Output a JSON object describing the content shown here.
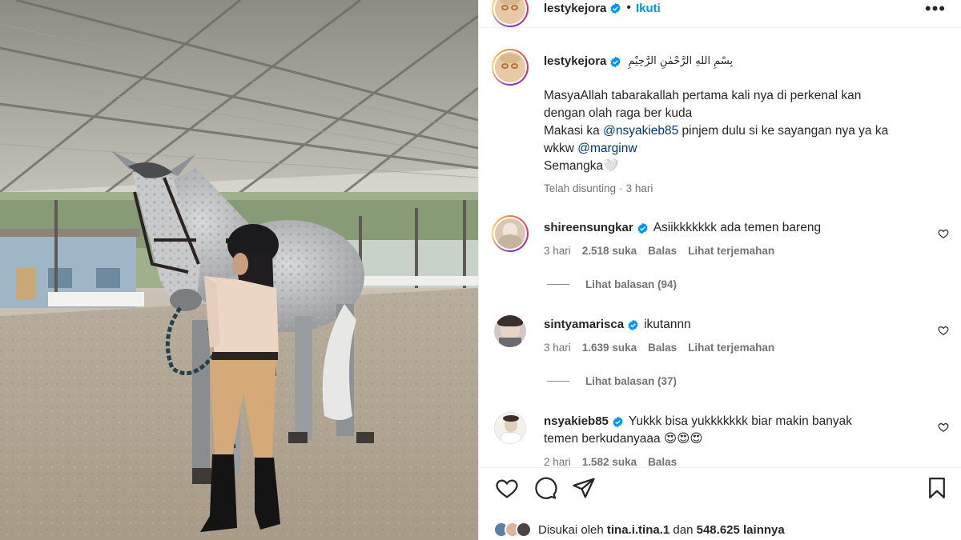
{
  "post": {
    "author": "lestykejora",
    "follow_label": "Ikuti",
    "more_icon": "more-horizontal-icon"
  },
  "caption": {
    "author": "lestykejora",
    "arabic": "بِسْمِ اللهِ الرَّحْمٰنِ الرَّحِيْمِ",
    "line1": "MasyaAllah tabarakallah pertama kali nya di perkenal kan",
    "line2": "dengan olah raga ber kuda",
    "line3_pre": "Makasi ka ",
    "line3_mention": "@nsyakieb85",
    "line3_post": " pinjem dulu si ke sayangan nya ya ka",
    "line4_pre": "wkkw ",
    "line4_mention": "@marginw",
    "line5": "Semangka🤍",
    "edited": "Telah disunting",
    "time": "3 hari"
  },
  "comments": [
    {
      "username": "shireensungkar",
      "text": "Asiikkkkkkk ada temen bareng",
      "time": "3 hari",
      "likes": "2.518 suka",
      "reply": "Balas",
      "translate": "Lihat terjemahan",
      "view_replies": "Lihat balasan (94)"
    },
    {
      "username": "sintyamarisca",
      "text": "ikutannn",
      "time": "3 hari",
      "likes": "1.639 suka",
      "reply": "Balas",
      "translate": "Lihat terjemahan",
      "view_replies": "Lihat balasan (37)"
    },
    {
      "username": "nsyakieb85",
      "text_line1": "Yukkk bisa yukkkkkkk biar makin banyak",
      "text_line2": "temen berkudanyaaa 😍😍😍",
      "time": "2 hari",
      "likes": "1.582 suka",
      "reply": "Balas"
    }
  ],
  "liked_by": {
    "prefix": "Disukai oleh ",
    "user": "tina.i.tina.1",
    "middle": " dan ",
    "count": "548.625 lainnya"
  },
  "colors": {
    "follow": "#0095f6",
    "verified": "#0095f6",
    "mention": "#00376b",
    "muted": "#737373"
  }
}
